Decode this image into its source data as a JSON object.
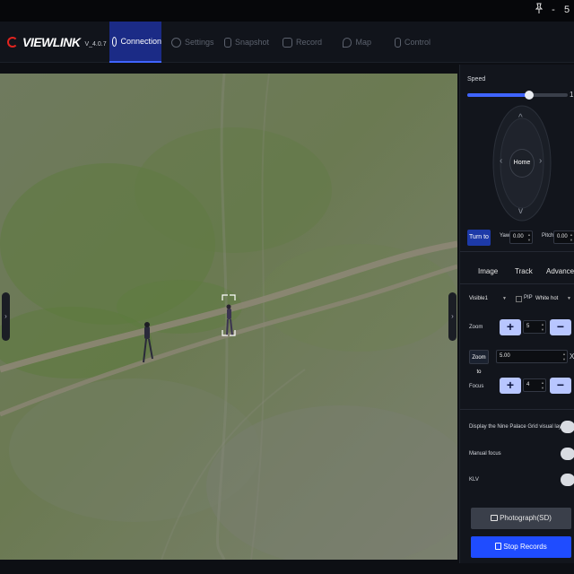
{
  "window": {
    "pin_icon": "pin-icon",
    "minimize_label": "-",
    "restore_label": "5"
  },
  "brand": {
    "name": "VIEWLINK",
    "version": "V_4.0.7"
  },
  "nav": {
    "tabs": [
      {
        "label": "Connection",
        "icon": "connection-icon",
        "active": true
      },
      {
        "label": "Settings",
        "icon": "settings-gear-icon",
        "active": false
      },
      {
        "label": "Snapshot",
        "icon": "snapshot-icon",
        "active": false
      },
      {
        "label": "Record",
        "icon": "record-icon",
        "active": false
      },
      {
        "label": "Map",
        "icon": "map-pin-icon",
        "active": false
      },
      {
        "label": "Control",
        "icon": "control-icon",
        "active": false
      }
    ]
  },
  "video": {
    "tracking_box": "tracking-target-box"
  },
  "panel": {
    "speed": {
      "label": "Speed",
      "value": "1",
      "level": 0.62
    },
    "dpad": {
      "home_label": "Home"
    },
    "turn_to": {
      "button_label": "Turn to",
      "yaw_label": "Yaw",
      "yaw_value": "0.00",
      "pitch_label": "Pitch",
      "pitch_value": "0.00"
    },
    "subtabs": {
      "image": "Image",
      "track": "Track",
      "advanced": "Advanced"
    },
    "image": {
      "source_select": "Visible1",
      "pip_label": "PIP",
      "palette_select": "White hot",
      "zoom_label": "Zoom",
      "zoom_value": "5",
      "zoom_to_button": "Zoom to",
      "zoom_to_value": "5.00",
      "zoom_unit": "X",
      "focus_label": "Focus",
      "focus_value": "4",
      "plus": "+",
      "minus": "−"
    },
    "toggles": {
      "nine_grid": "Display the Nine Palace Grid visual layer",
      "manual_focus": "Manual focus",
      "klv": "KLV"
    },
    "photograph": "Photograph(SD)",
    "stop_records": "Stop Records"
  },
  "colors": {
    "accent": "#3f64ff",
    "active_tab": "#1b2b86",
    "brand_red": "#e2241f",
    "stop_button": "#1f4cff"
  }
}
